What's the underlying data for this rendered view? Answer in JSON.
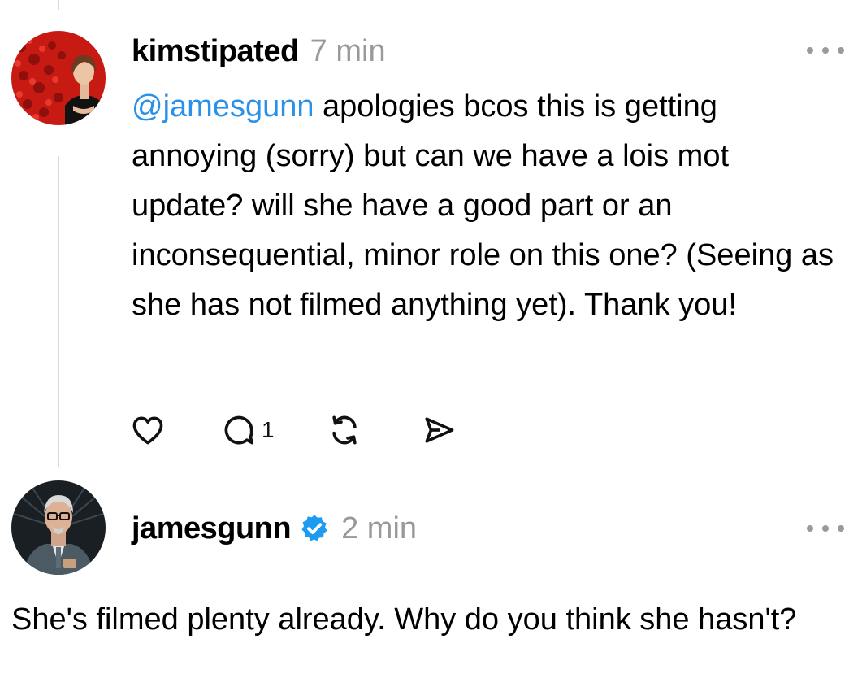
{
  "post": {
    "username": "kimstipated",
    "time": "7 min",
    "mention": "@jamesgunn",
    "text": " apologies bcos this is getting annoying (sorry) but can we have a lois mot update? will she have a good part or an inconsequential, minor role on this one? (Seeing as she has not filmed anything yet). Thank you!",
    "reply_count": "1"
  },
  "reply": {
    "username": "jamesgunn",
    "time": "2 min",
    "text": "She's filmed plenty already. Why do you think she hasn't?"
  },
  "colors": {
    "mention": "#2a91e8",
    "verified": "#1d9bf0",
    "muted": "#999999"
  },
  "icons": {
    "like": "heart-icon",
    "reply": "speech-bubble-icon",
    "repost": "repost-arrows-icon",
    "share": "paper-plane-icon",
    "more": "more-dots-icon",
    "verified": "verified-badge-icon"
  }
}
